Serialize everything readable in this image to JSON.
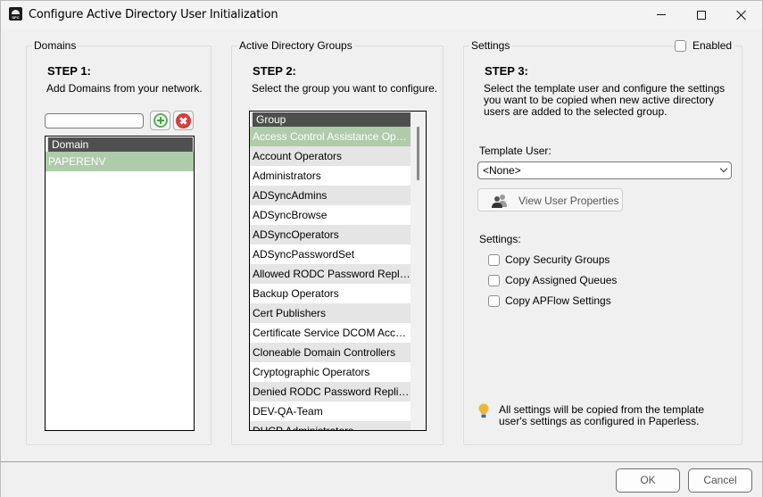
{
  "window": {
    "title": "Configure Active Directory User Initialization",
    "app_icon_text": "SPC",
    "controls": [
      "minimize",
      "maximize",
      "close"
    ]
  },
  "domains": {
    "legend": "Domains",
    "step": "STEP 1:",
    "description": "Add Domains from your network.",
    "input_value": "",
    "add_icon": "plus-circle-icon",
    "remove_icon": "x-circle-icon",
    "column_header": "Domain",
    "items": [
      {
        "label": "PAPERENV",
        "selected": true
      }
    ]
  },
  "groups": {
    "legend": "Active Directory Groups",
    "step": "STEP 2:",
    "description": "Select the group you want to configure.",
    "column_header": "Group",
    "items": [
      {
        "label": "Access Control Assistance Operat...",
        "selected": true
      },
      {
        "label": "Account Operators"
      },
      {
        "label": "Administrators"
      },
      {
        "label": "ADSyncAdmins"
      },
      {
        "label": "ADSyncBrowse"
      },
      {
        "label": "ADSyncOperators"
      },
      {
        "label": "ADSyncPasswordSet"
      },
      {
        "label": "Allowed RODC Password Replicati..."
      },
      {
        "label": "Backup Operators"
      },
      {
        "label": "Cert Publishers"
      },
      {
        "label": "Certificate Service DCOM Access"
      },
      {
        "label": "Cloneable Domain Controllers"
      },
      {
        "label": "Cryptographic Operators"
      },
      {
        "label": "Denied RODC Password Replicati..."
      },
      {
        "label": "DEV-QA-Team"
      },
      {
        "label": "DHCP Administrators"
      }
    ]
  },
  "settings": {
    "legend": "Settings",
    "enabled_label": "Enabled",
    "enabled_checked": false,
    "step": "STEP 3:",
    "description": "Select the template user and configure the settings you want to be copied when new active directory users are added to the selected group.",
    "template_user_label": "Template User:",
    "template_user_value": "<None>",
    "view_user_properties_label": "View User Properties",
    "settings_label": "Settings:",
    "options": [
      {
        "label": "Copy Security Groups",
        "checked": false
      },
      {
        "label": "Copy Assigned Queues",
        "checked": false
      },
      {
        "label": "Copy APFlow Settings",
        "checked": false
      }
    ],
    "note": "All settings will be copied from the template user's settings as configured in Paperless.",
    "note_icon": "lightbulb-icon"
  },
  "footer": {
    "ok_label": "OK",
    "cancel_label": "Cancel"
  },
  "colors": {
    "selection": "#b0cbab",
    "header": "#4f4f4f",
    "alt_row": "#e5e5e5",
    "add_green": "#5cae5c",
    "remove_red": "#d93b3b",
    "bulb_yellow": "#f2b632"
  }
}
